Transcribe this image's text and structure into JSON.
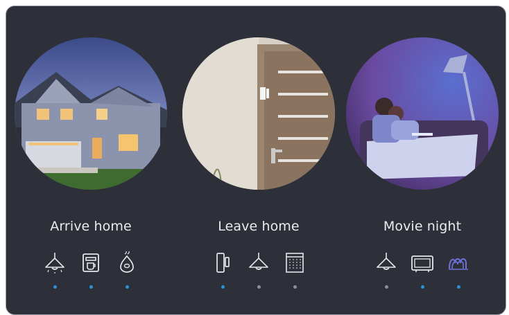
{
  "scenes": [
    {
      "title": "Arrive home",
      "photo_icon": "house-at-dusk-photo",
      "devices": [
        {
          "icon": "ceiling-lamp-icon",
          "active": true
        },
        {
          "icon": "coffee-machine-icon",
          "active": true
        },
        {
          "icon": "air-diffuser-icon",
          "active": true
        }
      ]
    },
    {
      "title": "Leave home",
      "photo_icon": "door-sensor-photo",
      "devices": [
        {
          "icon": "door-sensor-icon",
          "active": true
        },
        {
          "icon": "ceiling-lamp-icon",
          "active": false
        },
        {
          "icon": "window-blinds-icon",
          "active": false
        }
      ]
    },
    {
      "title": "Movie night",
      "photo_icon": "couple-on-sofa-photo",
      "devices": [
        {
          "icon": "ceiling-lamp-icon",
          "active": false
        },
        {
          "icon": "tv-icon",
          "active": true
        },
        {
          "icon": "light-strip-icon",
          "active": true
        }
      ]
    }
  ],
  "colors": {
    "card_bg": "#2e3039",
    "dot_active": "#2f8fd6",
    "dot_inactive": "#8d8f96",
    "icon_stroke": "#e6e7eb",
    "light_strip": "#6b73d8"
  }
}
